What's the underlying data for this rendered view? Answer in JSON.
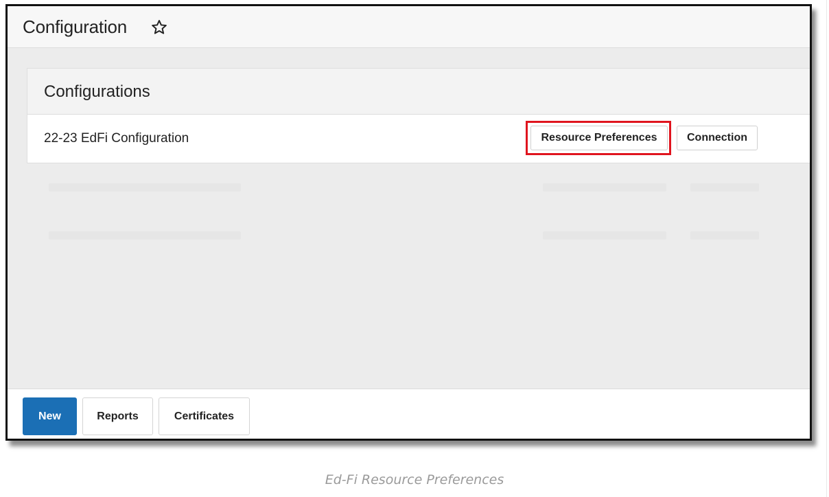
{
  "header": {
    "title": "Configuration"
  },
  "panel": {
    "title": "Configurations",
    "rows": [
      {
        "label": "22-23 EdFi Configuration",
        "resource_button": "Resource Preferences",
        "connection_button": "Connection"
      }
    ]
  },
  "footer": {
    "new_label": "New",
    "reports_label": "Reports",
    "certificates_label": "Certificates"
  },
  "caption": "Ed-Fi Resource Preferences",
  "colors": {
    "primary": "#1b6fb5",
    "highlight": "#e0141e"
  },
  "icons": {
    "favorite": "star-icon"
  }
}
